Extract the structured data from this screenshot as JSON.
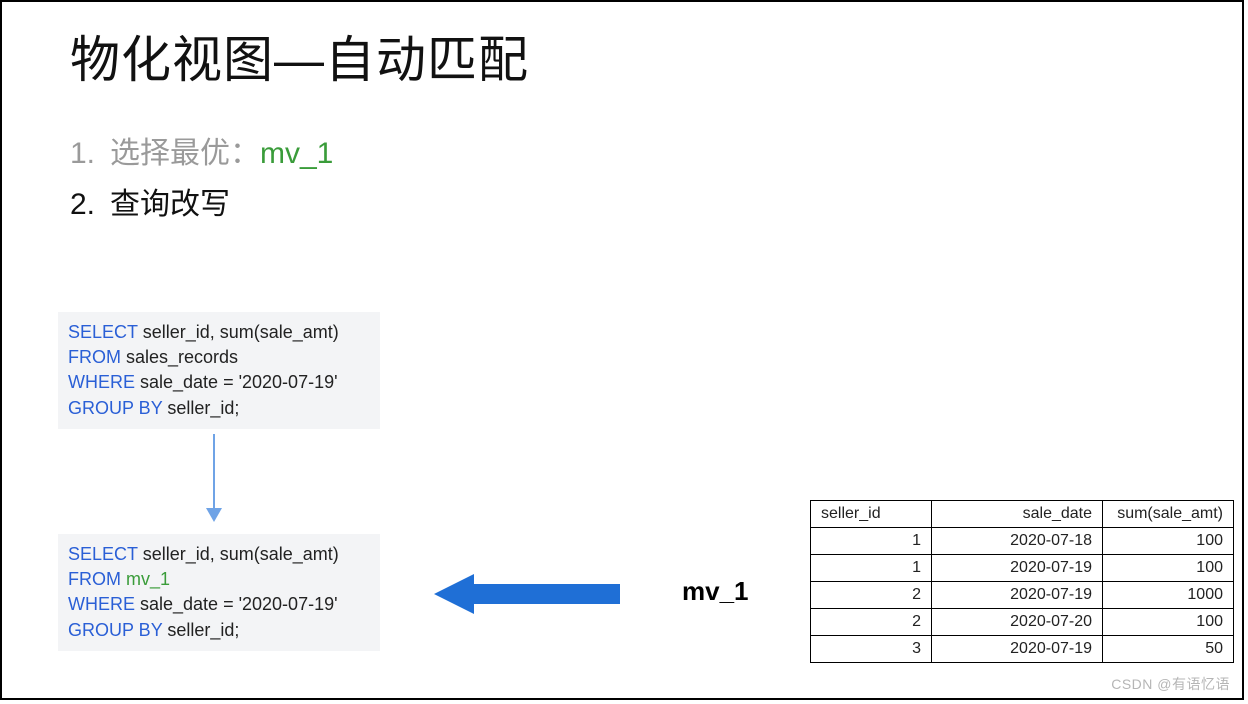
{
  "title": "物化视图—自动匹配",
  "list": {
    "item1_num": "1.",
    "item1_label": "选择最优：",
    "item1_value": "mv_1",
    "item2_num": "2.",
    "item2_label": "查询改写"
  },
  "sql_top": {
    "select_kw": "SELECT",
    "select_rest": " seller_id, sum(sale_amt)",
    "from_kw": "FROM",
    "from_rest": " sales_records",
    "where_kw": "WHERE",
    "where_rest": " sale_date = '2020-07-19'",
    "group_kw": "GROUP BY",
    "group_rest": " seller_id;"
  },
  "sql_bot": {
    "select_kw": "SELECT",
    "select_rest": " seller_id, sum(sale_amt)",
    "from_kw": "FROM",
    "from_rest": " mv_1",
    "where_kw": "WHERE",
    "where_rest": " sale_date = '2020-07-19'",
    "group_kw": "GROUP BY",
    "group_rest": " seller_id;"
  },
  "mv_label": "mv_1",
  "table": {
    "headers": [
      "seller_id",
      "sale_date",
      "sum(sale_amt)"
    ],
    "rows": [
      [
        "1",
        "2020-07-18",
        "100"
      ],
      [
        "1",
        "2020-07-19",
        "100"
      ],
      [
        "2",
        "2020-07-19",
        "1000"
      ],
      [
        "2",
        "2020-07-20",
        "100"
      ],
      [
        "3",
        "2020-07-19",
        "50"
      ]
    ]
  },
  "watermark": "CSDN @有语忆语",
  "colors": {
    "arrow_blue": "#1f6fd6"
  }
}
